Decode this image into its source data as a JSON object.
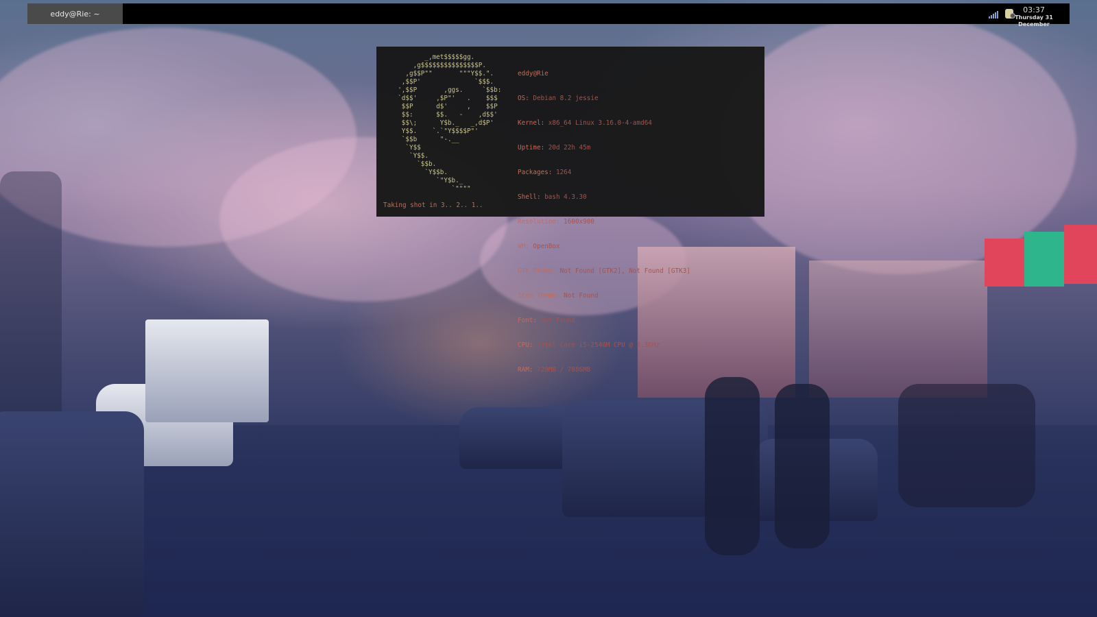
{
  "panel": {
    "task_label": "eddy@Rie: ~",
    "clock_time": "03:37",
    "clock_date": "Thursday 31 December",
    "tray_icons": [
      "network-signal-icon",
      "battery-icon"
    ]
  },
  "terminal": {
    "ascii_logo": "         _,met$$$$$gg.\n      ,g$$$$$$$$$$$$$$$P.\n    ,g$$P\"\"       \"\"\"Y$$.\".\n   ,$$P'              `$$$.\n  ',$$P       ,ggs.     `$$b:\n  `d$$'     ,$P\"'   .    $$$\n   $$P      d$'     ,    $$P\n   $$:      $$.   -    ,d$$'\n   $$\\;      Y$b._   _,d$P'\n   Y$$.    `.`\"Y$$$$P\"'\n   `$$b      \"-.__\n    `Y$$\n     `Y$$.\n       `$$b.\n         `Y$$b.\n            `\"Y$b._\n                `\"\"\"\"",
    "title": "eddy@Rie",
    "info": [
      {
        "key": "OS: ",
        "value": "Debian 8.2 jessie"
      },
      {
        "key": "Kernel: ",
        "value": "x86_64 Linux 3.16.0-4-amd64"
      },
      {
        "key": "Uptime: ",
        "value": "20d 22h 45m"
      },
      {
        "key": "Packages: ",
        "value": "1264"
      },
      {
        "key": "Shell: ",
        "value": "bash 4.3.30"
      },
      {
        "key": "Resolution: ",
        "value": "1600x900"
      },
      {
        "key": "WM: ",
        "value": "OpenBox"
      },
      {
        "key": "GTK Theme: ",
        "value": "Not Found [GTK2], Not Found [GTK3]"
      },
      {
        "key": "Icon Theme: ",
        "value": "Not Found"
      },
      {
        "key": "Font: ",
        "value": "Not Found"
      },
      {
        "key": "CPU: ",
        "value": "Intel Core i5-2540M CPU @ 3.3GHz"
      },
      {
        "key": "RAM: ",
        "value": "729MB / 7886MB"
      }
    ],
    "prompt": "Taking shot in 3.. 2.. 1.."
  },
  "colors": {
    "terminal_bg": "#181818",
    "ascii": "#c9c38a",
    "info_key": "#c86a55",
    "info_value": "#a8524a",
    "panel_bg": "#000000",
    "task_bg": "#4a4a4a"
  }
}
